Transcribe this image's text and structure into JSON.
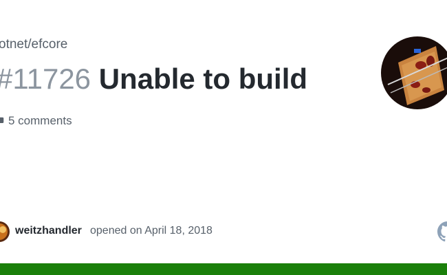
{
  "repo": {
    "name": "otnet/efcore"
  },
  "issue": {
    "number": "#11726",
    "title": "Unable to build",
    "comments": "5 comments",
    "author": "weitzhandler",
    "opened_text": "opened on April 18, 2018"
  },
  "colors": {
    "accent_bar": "#1a7f0a",
    "muted_text": "#57606a",
    "title_text": "#24292f",
    "number_text": "#8c959f"
  },
  "icons": [
    "comment-icon",
    "github-logo-icon"
  ]
}
